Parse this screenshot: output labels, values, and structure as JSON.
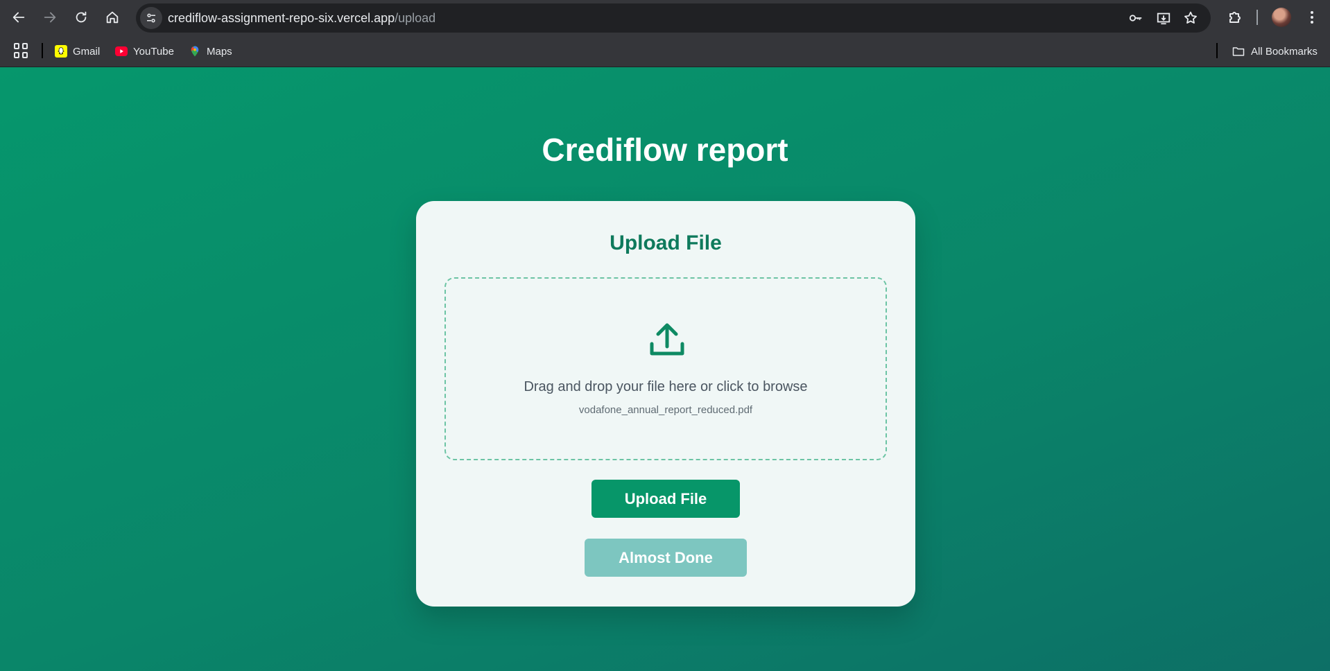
{
  "browser": {
    "url_host": "crediflow-assignment-repo-six.vercel.app",
    "url_path": "/upload",
    "bookmarks": [
      {
        "label": "Gmail",
        "icon": "snapchat-icon"
      },
      {
        "label": "YouTube",
        "icon": "youtube-icon"
      },
      {
        "label": "Maps",
        "icon": "maps-icon"
      }
    ],
    "all_bookmarks_label": "All Bookmarks"
  },
  "page": {
    "title": "Crediflow report",
    "card": {
      "title": "Upload File",
      "dropzone": {
        "icon": "upload-icon",
        "prompt": "Drag and drop your file here or click to browse",
        "selected_file": "vodafone_annual_report_reduced.pdf"
      },
      "upload_button": "Upload File",
      "almost_done_button": "Almost Done"
    }
  },
  "colors": {
    "brand_green": "#079669",
    "title_green": "#0e7a5c",
    "disabled_teal": "#7dc6c0",
    "card_bg": "#f0f7f6"
  }
}
